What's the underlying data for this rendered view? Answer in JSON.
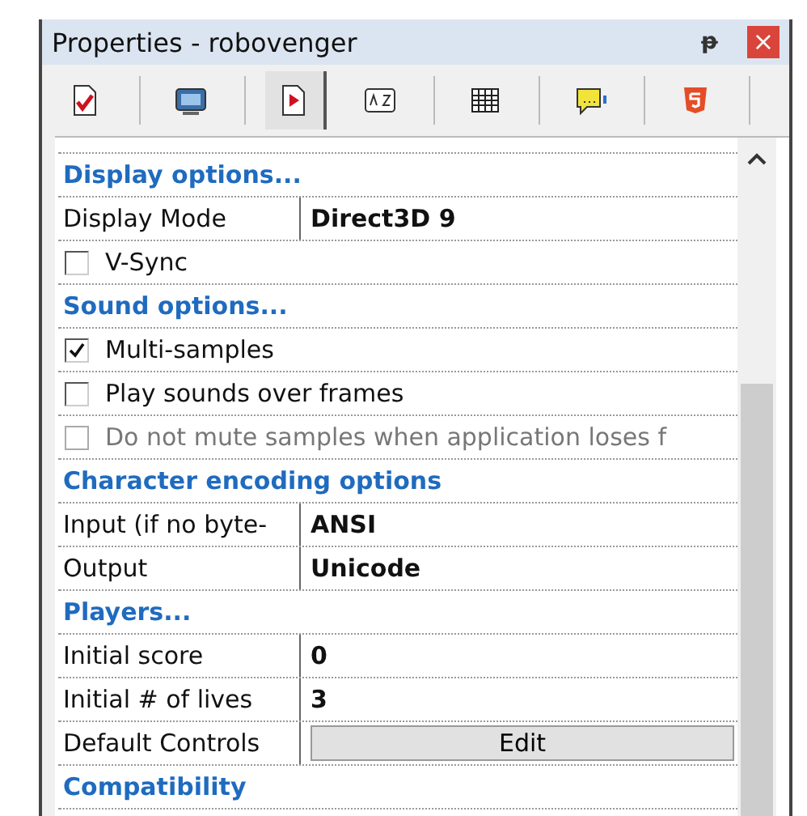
{
  "window": {
    "title": "Properties - robovenger",
    "pin": "ᵽ",
    "close": "×"
  },
  "toolbar": [
    {
      "selected": false
    },
    {
      "selected": false
    },
    {
      "selected": true
    },
    {
      "selected": false
    },
    {
      "selected": false
    },
    {
      "selected": false
    },
    {
      "selected": false
    }
  ],
  "rows": [
    {
      "kind": "category",
      "label": "Display options..."
    },
    {
      "kind": "value",
      "label": "Display Mode",
      "value": "Direct3D 9"
    },
    {
      "kind": "checkbox",
      "label": "V-Sync",
      "checked": false,
      "disabled": false
    },
    {
      "kind": "category",
      "label": "Sound options..."
    },
    {
      "kind": "checkbox",
      "label": "Multi-samples",
      "checked": true,
      "disabled": false
    },
    {
      "kind": "checkbox",
      "label": "Play sounds over frames",
      "checked": false,
      "disabled": false
    },
    {
      "kind": "checkbox",
      "label": "Do not mute samples when application loses f",
      "checked": false,
      "disabled": true
    },
    {
      "kind": "category",
      "label": "Character encoding options"
    },
    {
      "kind": "value",
      "label": "Input (if no byte-",
      "value": "ANSI"
    },
    {
      "kind": "value",
      "label": "Output",
      "value": "Unicode"
    },
    {
      "kind": "category",
      "label": "Players..."
    },
    {
      "kind": "value",
      "label": "Initial score",
      "value": "0"
    },
    {
      "kind": "value",
      "label": "Initial # of lives",
      "value": "3"
    },
    {
      "kind": "button",
      "label": "Default Controls",
      "value": "Edit"
    },
    {
      "kind": "category",
      "label": "Compatibility"
    }
  ]
}
